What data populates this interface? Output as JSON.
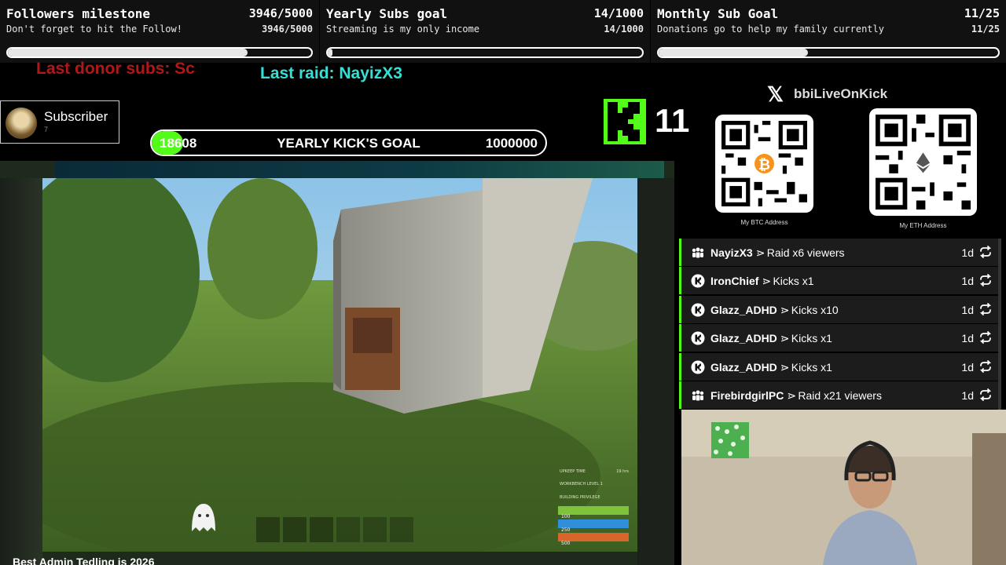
{
  "goals": [
    {
      "title": "Followers milestone",
      "count": "3946/5000",
      "subtitle": "Don't forget to hit the Follow!",
      "count_repeat": "3946/5000",
      "progress": 0.789
    },
    {
      "title": "Yearly Subs goal",
      "count": "14/1000",
      "subtitle": "Streaming is my only income",
      "count_repeat": "14/1000",
      "progress": 0.014
    },
    {
      "title": "Monthly Sub Goal",
      "count": "11/25",
      "subtitle": "Donations go to help my family currently",
      "count_repeat": "11/25",
      "progress": 0.44
    }
  ],
  "tickers": {
    "last_donor": "Last donor subs: Sc",
    "last_raid": "Last raid: NayizX3",
    "bottom_text": "Best Admin Tedling is 2026"
  },
  "subscriber": {
    "label": "Subscriber",
    "count": "7"
  },
  "kick_goal": {
    "current": "18608",
    "title": "YEARLY KICK'S GOAL",
    "target": "1000000",
    "progress": 0.0186
  },
  "kick_counter": {
    "value": "11"
  },
  "social": {
    "handle": "bbiLiveOnKick"
  },
  "qr_codes": [
    {
      "label": "My BTC Address",
      "coin": "bitcoin-icon"
    },
    {
      "label": "My ETH Address",
      "coin": "ethereum-icon"
    }
  ],
  "game_hud": {
    "upkeep": "UPKEEP TIME",
    "upkeep_val": "19 hrs",
    "workbench": "WORKBENCH LEVEL 1",
    "privilege": "BUILDING PRIVILEGE",
    "health": "100",
    "water": "250",
    "food": "500"
  },
  "feed": [
    {
      "name": "NayizX3",
      "action": "Raid x6 viewers",
      "time": "1d",
      "icon": "raid-icon"
    },
    {
      "name": "IronChief",
      "action": "Kicks x1",
      "time": "1d",
      "icon": "kick-icon"
    },
    {
      "name": "Glazz_ADHD",
      "action": "Kicks x10",
      "time": "1d",
      "icon": "kick-icon"
    },
    {
      "name": "Glazz_ADHD",
      "action": "Kicks x1",
      "time": "1d",
      "icon": "kick-icon"
    },
    {
      "name": "Glazz_ADHD",
      "action": "Kicks x1",
      "time": "1d",
      "icon": "kick-icon"
    },
    {
      "name": "FirebirdgirlPC",
      "action": "Raid x21 viewers",
      "time": "1d",
      "icon": "raid-icon"
    }
  ],
  "colors": {
    "kick_green": "#53fc18",
    "donor_red": "#b01818",
    "raid_cyan": "#33e0d6",
    "health": "#7fc33a",
    "water": "#2f8fd8",
    "food": "#d8652a"
  }
}
